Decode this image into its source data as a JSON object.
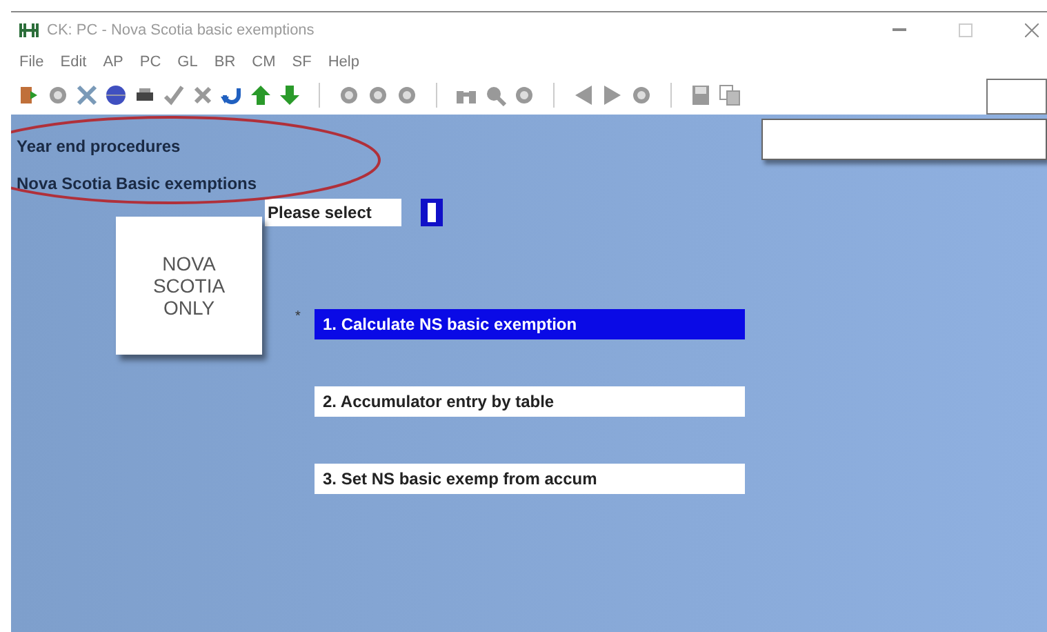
{
  "window": {
    "title": "CK: PC - Nova Scotia basic exemptions"
  },
  "menu": [
    "File",
    "Edit",
    "AP",
    "PC",
    "GL",
    "BR",
    "CM",
    "SF",
    "Help"
  ],
  "header": {
    "line_1": "Year end procedures",
    "line_2": "Nova Scotia Basic exemptions"
  },
  "prompt": {
    "label": "Please select"
  },
  "note": {
    "lines": [
      "NOVA",
      "SCOTIA",
      "ONLY"
    ]
  },
  "marker": "*",
  "options": [
    {
      "label": "1. Calculate NS basic exemption",
      "selected": true
    },
    {
      "label": "2. Accumulator entry by table",
      "selected": false
    },
    {
      "label": "3. Set NS basic exemp from accum",
      "selected": false
    }
  ]
}
